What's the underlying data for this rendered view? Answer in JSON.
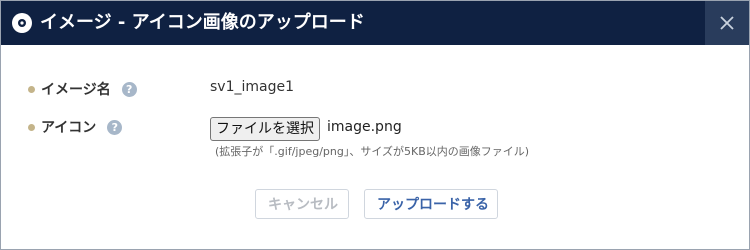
{
  "dialog": {
    "title": "イメージ - アイコン画像のアップロード",
    "close_symbol": "✕"
  },
  "form": {
    "image_name": {
      "label": "イメージ名",
      "help": "?",
      "value": "sv1_image1"
    },
    "icon": {
      "label": "アイコン",
      "help": "?",
      "file_button_label": "ファイルを選択",
      "file_name": "image.png",
      "hint": "(拡張子が「.gif/jpeg/png」、サイズが5KB以内の画像ファイル)"
    }
  },
  "actions": {
    "cancel_label": "キャンセル",
    "upload_label": "アップロードする"
  },
  "icons": {
    "title": "disc-icon",
    "close": "close-icon",
    "help": "help-icon"
  },
  "colors": {
    "titlebar": "#0f2142",
    "close_button": "#293c5c",
    "bullet": "#c4b48a",
    "help_icon": "#a7b7c9",
    "upload_text": "#3a63a8",
    "cancel_text": "#b8bcc2"
  }
}
